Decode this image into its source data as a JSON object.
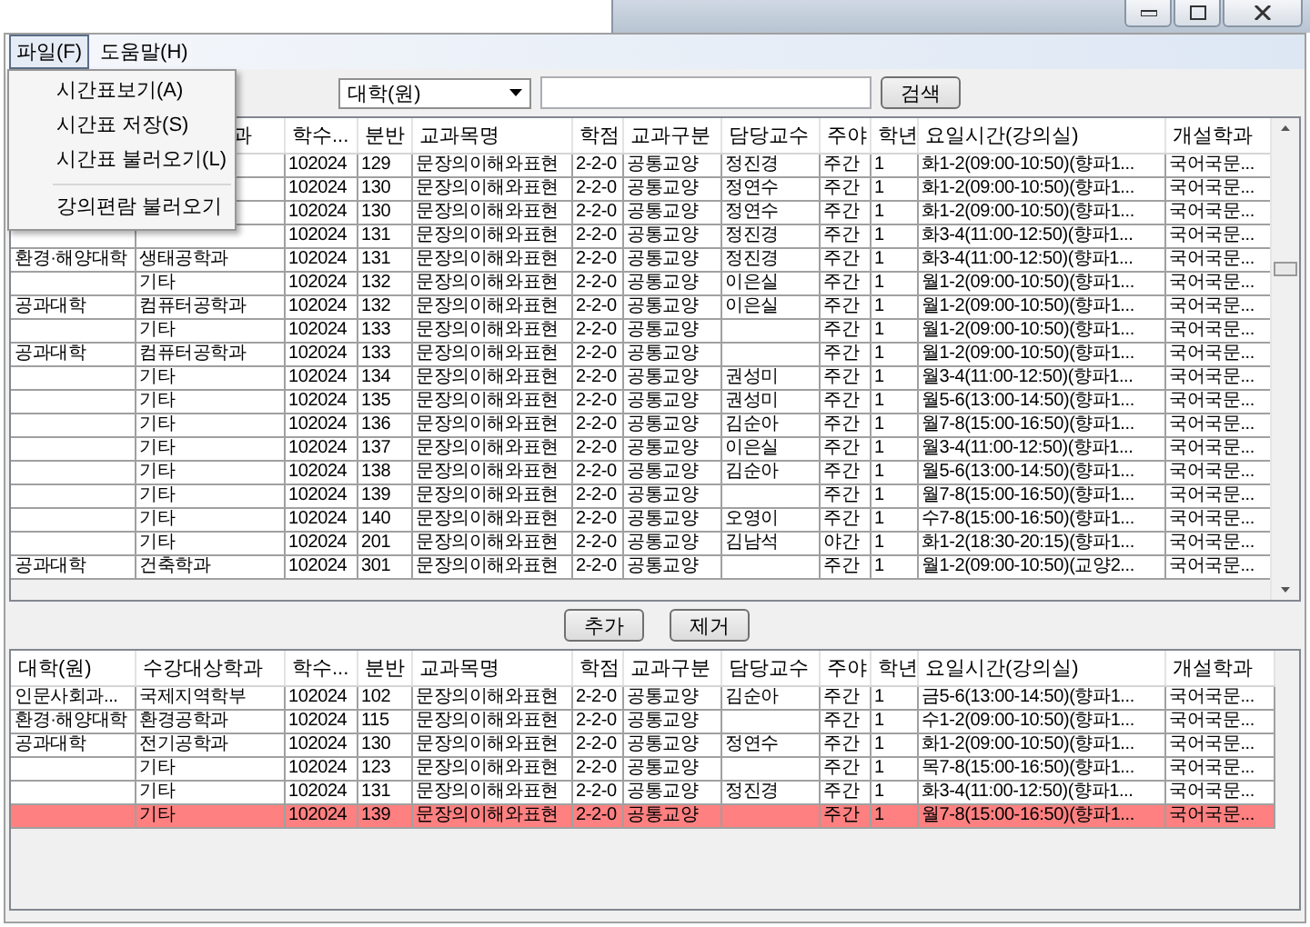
{
  "menu_bar": [
    {
      "label": "파일(F)",
      "selected": true
    },
    {
      "label": "도움말(H)",
      "selected": false
    }
  ],
  "file_menu": {
    "items": [
      {
        "kind": "item",
        "label": "시간표보기(A)"
      },
      {
        "kind": "item",
        "label": "시간표 저장(S)"
      },
      {
        "kind": "item",
        "label": "시간표 불러오기(L)"
      },
      {
        "kind": "separator"
      },
      {
        "kind": "item",
        "label": "강의편람 불러오기"
      }
    ]
  },
  "toolbar": {
    "dropdown": "대학(원)",
    "search_button": "검색"
  },
  "course_table": {
    "columns": [
      null,
      {
        "label": "과",
        "cut": true
      },
      {
        "label": "학수..."
      },
      {
        "label": "분반"
      },
      {
        "label": "교과목명"
      },
      {
        "label": "학점"
      },
      {
        "label": "교과구분"
      },
      {
        "label": "담당교수"
      },
      {
        "label": "주야"
      },
      {
        "label": "학년"
      },
      {
        "label": "요일시간(강의실)"
      },
      {
        "label": "개설학과"
      }
    ],
    "rows": [
      {
        "selected": false,
        "cells": [
          null,
          null,
          "102024",
          "129",
          "문장의이해와표현",
          "2-2-0",
          "공통교양",
          "정진경",
          "주간",
          "1",
          "화1-2(09:00-10:50)(향파1...",
          "국어국문..."
        ]
      },
      {
        "selected": false,
        "cells": [
          null,
          null,
          "102024",
          "130",
          "문장의이해와표현",
          "2-2-0",
          "공통교양",
          "정연수",
          "주간",
          "1",
          "화1-2(09:00-10:50)(향파1...",
          "국어국문..."
        ]
      },
      {
        "selected": false,
        "cells": [
          null,
          null,
          "102024",
          "130",
          "문장의이해와표현",
          "2-2-0",
          "공통교양",
          "정연수",
          "주간",
          "1",
          "화1-2(09:00-10:50)(향파1...",
          "국어국문..."
        ]
      },
      {
        "selected": false,
        "cells": [
          null,
          null,
          "102024",
          "131",
          "문장의이해와표현",
          "2-2-0",
          "공통교양",
          "정진경",
          "주간",
          "1",
          "화3-4(11:00-12:50)(향파1...",
          "국어국문..."
        ]
      },
      {
        "selected": false,
        "cells": [
          "환경·해양대학",
          "생태공학과",
          "102024",
          "131",
          "문장의이해와표현",
          "2-2-0",
          "공통교양",
          "정진경",
          "주간",
          "1",
          "화3-4(11:00-12:50)(향파1...",
          "국어국문..."
        ]
      },
      {
        "selected": false,
        "cells": [
          null,
          "기타",
          "102024",
          "132",
          "문장의이해와표현",
          "2-2-0",
          "공통교양",
          "이은실",
          "주간",
          "1",
          "월1-2(09:00-10:50)(향파1...",
          "국어국문..."
        ]
      },
      {
        "selected": false,
        "cells": [
          "공과대학",
          "컴퓨터공학과",
          "102024",
          "132",
          "문장의이해와표현",
          "2-2-0",
          "공통교양",
          "이은실",
          "주간",
          "1",
          "월1-2(09:00-10:50)(향파1...",
          "국어국문..."
        ]
      },
      {
        "selected": false,
        "cells": [
          null,
          "기타",
          "102024",
          "133",
          "문장의이해와표현",
          "2-2-0",
          "공통교양",
          null,
          "주간",
          "1",
          "월1-2(09:00-10:50)(향파1...",
          "국어국문..."
        ]
      },
      {
        "selected": false,
        "cells": [
          "공과대학",
          "컴퓨터공학과",
          "102024",
          "133",
          "문장의이해와표현",
          "2-2-0",
          "공통교양",
          null,
          "주간",
          "1",
          "월1-2(09:00-10:50)(향파1...",
          "국어국문..."
        ]
      },
      {
        "selected": false,
        "cells": [
          null,
          "기타",
          "102024",
          "134",
          "문장의이해와표현",
          "2-2-0",
          "공통교양",
          "권성미",
          "주간",
          "1",
          "월3-4(11:00-12:50)(향파1...",
          "국어국문..."
        ]
      },
      {
        "selected": false,
        "cells": [
          null,
          "기타",
          "102024",
          "135",
          "문장의이해와표현",
          "2-2-0",
          "공통교양",
          "권성미",
          "주간",
          "1",
          "월5-6(13:00-14:50)(향파1...",
          "국어국문..."
        ]
      },
      {
        "selected": false,
        "cells": [
          null,
          "기타",
          "102024",
          "136",
          "문장의이해와표현",
          "2-2-0",
          "공통교양",
          "김순아",
          "주간",
          "1",
          "월7-8(15:00-16:50)(향파1...",
          "국어국문..."
        ]
      },
      {
        "selected": false,
        "cells": [
          null,
          "기타",
          "102024",
          "137",
          "문장의이해와표현",
          "2-2-0",
          "공통교양",
          "이은실",
          "주간",
          "1",
          "월3-4(11:00-12:50)(향파1...",
          "국어국문..."
        ]
      },
      {
        "selected": false,
        "cells": [
          null,
          "기타",
          "102024",
          "138",
          "문장의이해와표현",
          "2-2-0",
          "공통교양",
          "김순아",
          "주간",
          "1",
          "월5-6(13:00-14:50)(향파1...",
          "국어국문..."
        ]
      },
      {
        "selected": false,
        "cells": [
          null,
          "기타",
          "102024",
          "139",
          "문장의이해와표현",
          "2-2-0",
          "공통교양",
          null,
          "주간",
          "1",
          "월7-8(15:00-16:50)(향파1...",
          "국어국문..."
        ]
      },
      {
        "selected": false,
        "cells": [
          null,
          "기타",
          "102024",
          "140",
          "문장의이해와표현",
          "2-2-0",
          "공통교양",
          "오영이",
          "주간",
          "1",
          "수7-8(15:00-16:50)(향파1...",
          "국어국문..."
        ]
      },
      {
        "selected": false,
        "cells": [
          null,
          "기타",
          "102024",
          "201",
          "문장의이해와표현",
          "2-2-0",
          "공통교양",
          "김남석",
          "야간",
          "1",
          "화1-2(18:30-20:15)(향파1...",
          "국어국문..."
        ]
      },
      {
        "selected": false,
        "cells": [
          "공과대학",
          "건축학과",
          "102024",
          "301",
          "문장의이해와표현",
          "2-2-0",
          "공통교양",
          null,
          "주간",
          "1",
          "월1-2(09:00-10:50)(교양2...",
          "국어국문..."
        ]
      }
    ]
  },
  "actions": {
    "add_button": "추가",
    "remove_button": "제거"
  },
  "selected_table": {
    "columns": [
      {
        "label": "대학(원)"
      },
      {
        "label": "수강대상학과"
      },
      {
        "label": "학수..."
      },
      {
        "label": "분반"
      },
      {
        "label": "교과목명"
      },
      {
        "label": "학점"
      },
      {
        "label": "교과구분"
      },
      {
        "label": "담당교수"
      },
      {
        "label": "주야"
      },
      {
        "label": "학년"
      },
      {
        "label": "요일시간(강의실)"
      },
      {
        "label": "개설학과"
      }
    ],
    "rows": [
      {
        "selected": false,
        "cells": [
          "인문사회과...",
          "국제지역학부",
          "102024",
          "102",
          "문장의이해와표현",
          "2-2-0",
          "공통교양",
          "김순아",
          "주간",
          "1",
          "금5-6(13:00-14:50)(향파1...",
          "국어국문..."
        ]
      },
      {
        "selected": false,
        "cells": [
          "환경·해양대학",
          "환경공학과",
          "102024",
          "115",
          "문장의이해와표현",
          "2-2-0",
          "공통교양",
          null,
          "주간",
          "1",
          "수1-2(09:00-10:50)(향파1...",
          "국어국문..."
        ]
      },
      {
        "selected": false,
        "cells": [
          "공과대학",
          "전기공학과",
          "102024",
          "130",
          "문장의이해와표현",
          "2-2-0",
          "공통교양",
          "정연수",
          "주간",
          "1",
          "화1-2(09:00-10:50)(향파1...",
          "국어국문..."
        ]
      },
      {
        "selected": false,
        "cells": [
          null,
          "기타",
          "102024",
          "123",
          "문장의이해와표현",
          "2-2-0",
          "공통교양",
          null,
          "주간",
          "1",
          "목7-8(15:00-16:50)(향파1...",
          "국어국문..."
        ]
      },
      {
        "selected": false,
        "cells": [
          null,
          "기타",
          "102024",
          "131",
          "문장의이해와표현",
          "2-2-0",
          "공통교양",
          "정진경",
          "주간",
          "1",
          "화3-4(11:00-12:50)(향파1...",
          "국어국문..."
        ]
      },
      {
        "selected": true,
        "cells": [
          null,
          "기타",
          "102024",
          "139",
          "문장의이해와표현",
          "2-2-0",
          "공통교양",
          null,
          "주간",
          "1",
          "월7-8(15:00-16:50)(향파1...",
          "국어국문..."
        ]
      }
    ]
  }
}
